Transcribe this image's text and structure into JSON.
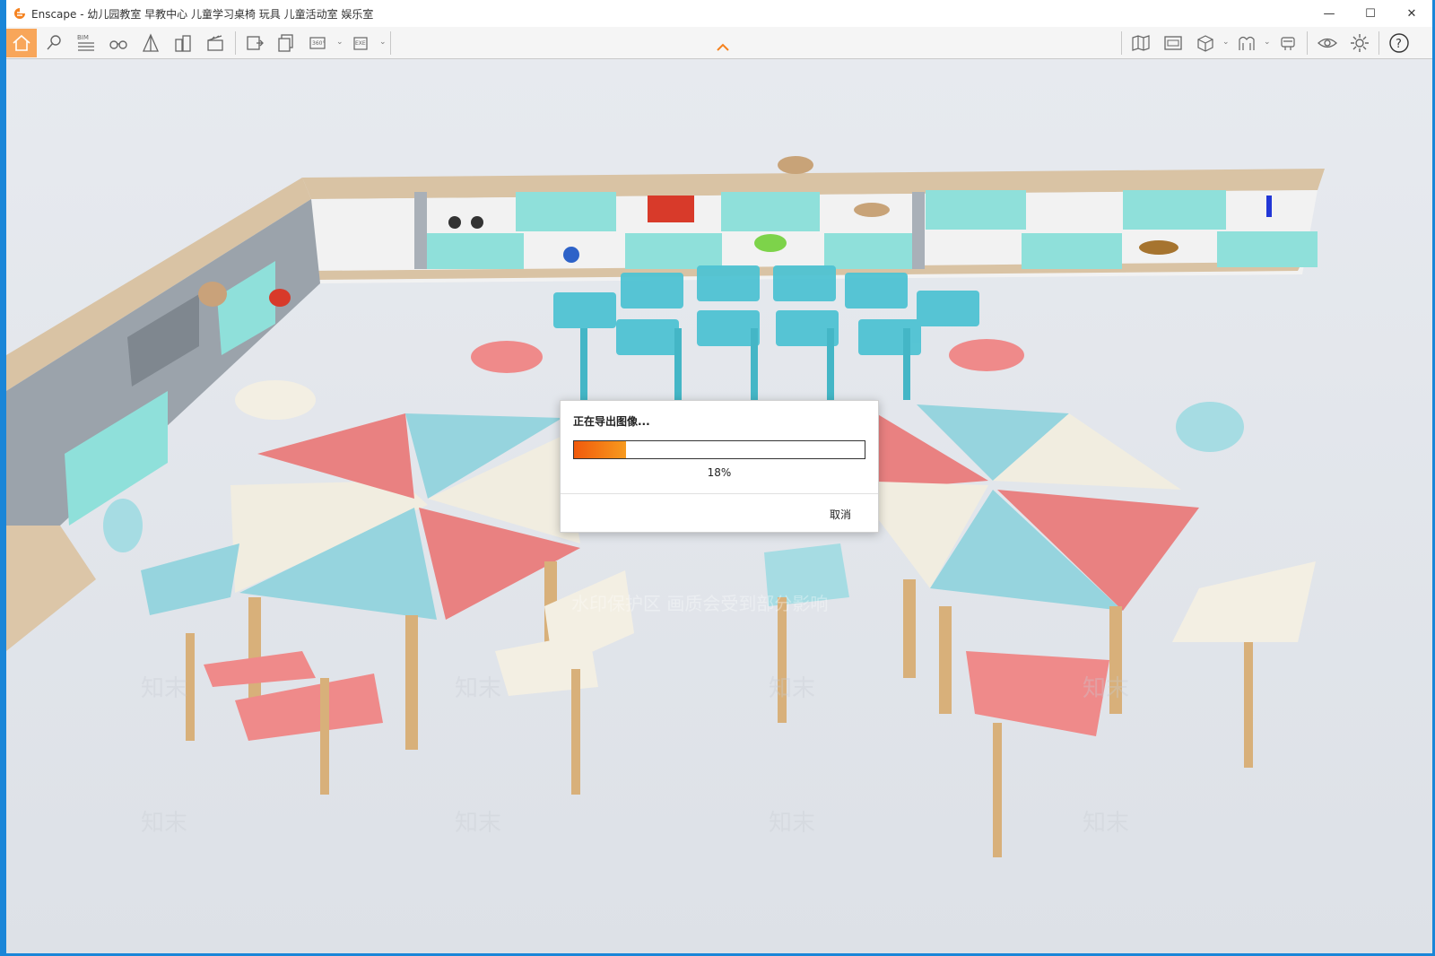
{
  "window": {
    "title": "Enscape - 幼儿园教室 早教中心 儿童学习桌椅 玩具 儿童活动室 娱乐室",
    "controls": {
      "minimize": "—",
      "maximize": "☐",
      "close": "✕"
    }
  },
  "toolbar": {
    "left_icons": [
      "home-icon",
      "location-pin-icon",
      "bim-icon",
      "binoculars-icon",
      "perspective-icon",
      "buildings-icon",
      "clapperboard-icon",
      "screenshot-export-icon",
      "batch-export-icon",
      "panorama-360-icon",
      "exe-export-icon"
    ],
    "right_icons": [
      "map-icon",
      "render-preview-icon",
      "asset-box-icon",
      "material-editor-icon",
      "sun-settings-icon",
      "visual-settings-icon",
      "settings-gear-icon",
      "help-icon"
    ],
    "bim_label": "BIM",
    "pano_label": "360°",
    "exe_label": "EXE",
    "help_label": "?"
  },
  "accent_color": "#f5821f",
  "export_dialog": {
    "title": "正在导出图像...",
    "progress_percent": 18,
    "progress_text": "18%",
    "cancel_label": "取消"
  },
  "watermark": {
    "center_text": "水印保护区  画质会受到部分影响",
    "logo_text": "知末"
  }
}
